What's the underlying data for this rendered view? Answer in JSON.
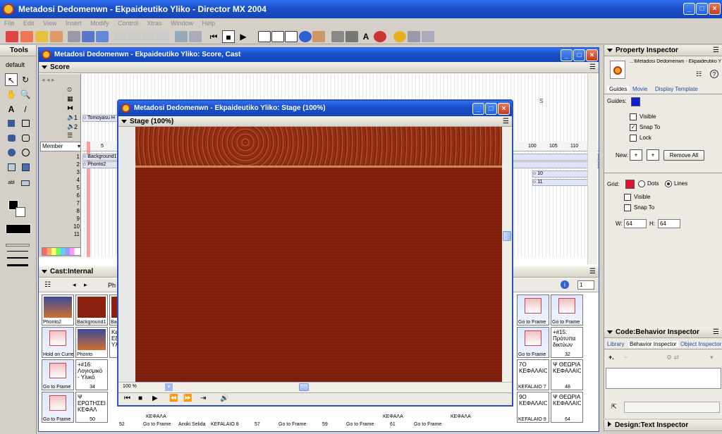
{
  "app": {
    "title": "Metadosi Dedomenwn - Ekpaideutiko Yliko - Director MX 2004"
  },
  "menu": [
    "File",
    "Edit",
    "View",
    "Insert",
    "Modify",
    "Control",
    "Xtras",
    "Window",
    "Help"
  ],
  "tools": {
    "title": "Tools",
    "preset": "default"
  },
  "score_cast": {
    "title": "Metadosi Dedomenwn - Ekpaideutiko Yliko: Score, Cast",
    "score_label": "Score",
    "member_label": "Member",
    "frame_ticks": [
      "5",
      "100",
      "105",
      "110"
    ],
    "sound1": "1",
    "sound2": "2",
    "channel_text": "Tomoyasu H",
    "sprite1": "Background1",
    "sprite2": "Phonto2",
    "track_a": "10",
    "track_b": "11",
    "channels": [
      "1",
      "2",
      "3",
      "4",
      "5",
      "6",
      "7",
      "8",
      "9",
      "10",
      "11"
    ],
    "marker": "S"
  },
  "stage": {
    "title": "Metadosi Dedomenwn - Ekpaideutiko Yliko: Stage (100%)",
    "panel_label": "Stage (100%)",
    "zoom": "100 %"
  },
  "cast": {
    "title": "Cast:Internal",
    "page": "1",
    "prefix": "Ph",
    "left_cells": [
      {
        "label": "Phonto2",
        "kind": "img"
      },
      {
        "label": "Background1",
        "kind": "bg"
      },
      {
        "label": "Bac",
        "kind": "bg"
      },
      {
        "label": "Hold on Curre",
        "kind": "bhv"
      },
      {
        "label": "Phonto",
        "kind": "img"
      },
      {
        "label": "Κε Εξ Υλ",
        "kind": "text"
      },
      {
        "label": "Go to Frame",
        "kind": "bhv"
      },
      {
        "label": "34",
        "kind": "text",
        "text": "+#16: Λογισμικό - Υλικό"
      },
      {
        "label": "Go to Frame",
        "kind": "bhv"
      },
      {
        "label": "50",
        "kind": "text",
        "text": "Ψ ΕΡΩΤΗΣΕΙΣ ΚΕΦΑΛ"
      }
    ],
    "bottom_labels": [
      "52",
      "Go to Frame",
      "Arxiki Selida",
      "KEFALAIO 8",
      "57",
      "Go to Frame",
      "59",
      "Go to Frame",
      "61",
      "Go to Frame"
    ],
    "bottom_texts": [
      "ΚΕΦΑΛΑ",
      "ΚΕΦΑΛΑ",
      "ΚΕΦΑΛΑ"
    ],
    "right_cells": [
      {
        "label": "Go to Frame",
        "kind": "bhv"
      },
      {
        "label": "Go to Frame",
        "kind": "bhv"
      },
      {
        "label": "Go to Frame",
        "kind": "bhv"
      },
      {
        "label": "32",
        "kind": "text",
        "text": "+#15: Πρότυπα δικτύων"
      },
      {
        "label": "KEFALAIO 7",
        "kind": "text",
        "text": "7Ο ΚΕΦΑΛΑΙΟ"
      },
      {
        "label": "48",
        "kind": "text",
        "text": "Ψ ΘΕΩΡΙΑ ΚΕΦΑΛΑΙΟ"
      },
      {
        "label": "KEFALAIO 9",
        "kind": "text",
        "text": "9Ο ΚΕΦΑΛΑΙΟ"
      },
      {
        "label": "64",
        "kind": "text",
        "text": "Ψ ΘΕΩΡΙΑ ΚΕΦΑΛΑΙΟ"
      }
    ]
  },
  "property_inspector": {
    "title": "Property Inspector",
    "file": "...\\Metadosi Dedomenwn - Ekpaideutiko Yliko",
    "tabs": [
      "Guides",
      "Movie",
      "Display Template"
    ],
    "guides_label": "Guides:",
    "visible": "Visible",
    "snap_to": "Snap To",
    "lock": "Lock",
    "new_label": "New:",
    "remove_all": "Remove All",
    "grid_label": "Grid:",
    "dots": "Dots",
    "lines": "Lines",
    "grid_visible": "Visible",
    "grid_snap": "Snap To",
    "w_label": "W:",
    "w_value": "64",
    "h_label": "H:",
    "h_value": "64"
  },
  "behavior_inspector": {
    "title": "Code:Behavior Inspector",
    "tabs": [
      "Library",
      "Behavior Inspector",
      "Object Inspector"
    ]
  },
  "design": {
    "title": "Design:Text Inspector"
  }
}
